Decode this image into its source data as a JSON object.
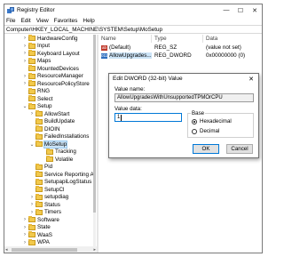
{
  "window": {
    "title": "Registry Editor",
    "controls": {
      "minimize": "—",
      "maximize": "☐",
      "close": "✕"
    }
  },
  "menu": [
    "File",
    "Edit",
    "View",
    "Favorites",
    "Help"
  ],
  "address": "Computer\\HKEY_LOCAL_MACHINE\\SYSTEM\\Setup\\MoSetup",
  "tree": {
    "items": [
      {
        "label": "HardwareConfig",
        "expander": "›"
      },
      {
        "label": "Input",
        "expander": "›"
      },
      {
        "label": "Keyboard Layout",
        "expander": "›"
      },
      {
        "label": "Maps",
        "expander": "›"
      },
      {
        "label": "MountedDevices",
        "expander": ""
      },
      {
        "label": "ResourceManager",
        "expander": "›"
      },
      {
        "label": "ResourcePolicyStore",
        "expander": "›"
      },
      {
        "label": "RNG",
        "expander": ""
      },
      {
        "label": "Select",
        "expander": ""
      },
      {
        "label": "Setup",
        "expander": "⌄"
      },
      {
        "label": "AllowStart",
        "expander": "›"
      },
      {
        "label": "BuildUpdate",
        "expander": ""
      },
      {
        "label": "DIOIN",
        "expander": ""
      },
      {
        "label": "FailedInstallations",
        "expander": ""
      },
      {
        "label": "MoSetup",
        "expander": "⌄"
      },
      {
        "label": "Tracking",
        "expander": ""
      },
      {
        "label": "Volatile",
        "expander": ""
      },
      {
        "label": "Pid",
        "expander": ""
      },
      {
        "label": "Service Reporting A",
        "expander": ""
      },
      {
        "label": "SetupapiLogStatus",
        "expander": ""
      },
      {
        "label": "SetupCl",
        "expander": ""
      },
      {
        "label": "setupdiag",
        "expander": "›"
      },
      {
        "label": "Status",
        "expander": "›"
      },
      {
        "label": "Timers",
        "expander": "›"
      },
      {
        "label": "Software",
        "expander": "›"
      },
      {
        "label": "State",
        "expander": "›"
      },
      {
        "label": "WaaS",
        "expander": "›"
      },
      {
        "label": "WPA",
        "expander": "›"
      }
    ]
  },
  "values_table": {
    "headers": [
      "Name",
      "Type",
      "Data"
    ],
    "rows": [
      {
        "icon": "ab",
        "name": "(Default)",
        "type": "REG_SZ",
        "data": "(value not set)"
      },
      {
        "icon": "011",
        "name": "AllowUpgrades...",
        "type": "REG_DWORD",
        "data": "0x00000000 (0)"
      }
    ]
  },
  "dialog": {
    "title": "Edit DWORD (32-bit) Value",
    "close": "✕",
    "value_name_label": "Value name:",
    "value_name": "AllowUpgradesWithUnsupportedTPMOrCPU",
    "value_data_label": "Value data:",
    "value_data": "1",
    "base_label": "Base",
    "base_options": [
      {
        "label": "Hexadecimal",
        "selected": true
      },
      {
        "label": "Decimal",
        "selected": false
      }
    ],
    "ok_label": "OK",
    "cancel_label": "Cancel"
  },
  "colors": {
    "selection": "#cce4f7",
    "folder": "#f2c94c",
    "accent": "#0078d7"
  }
}
